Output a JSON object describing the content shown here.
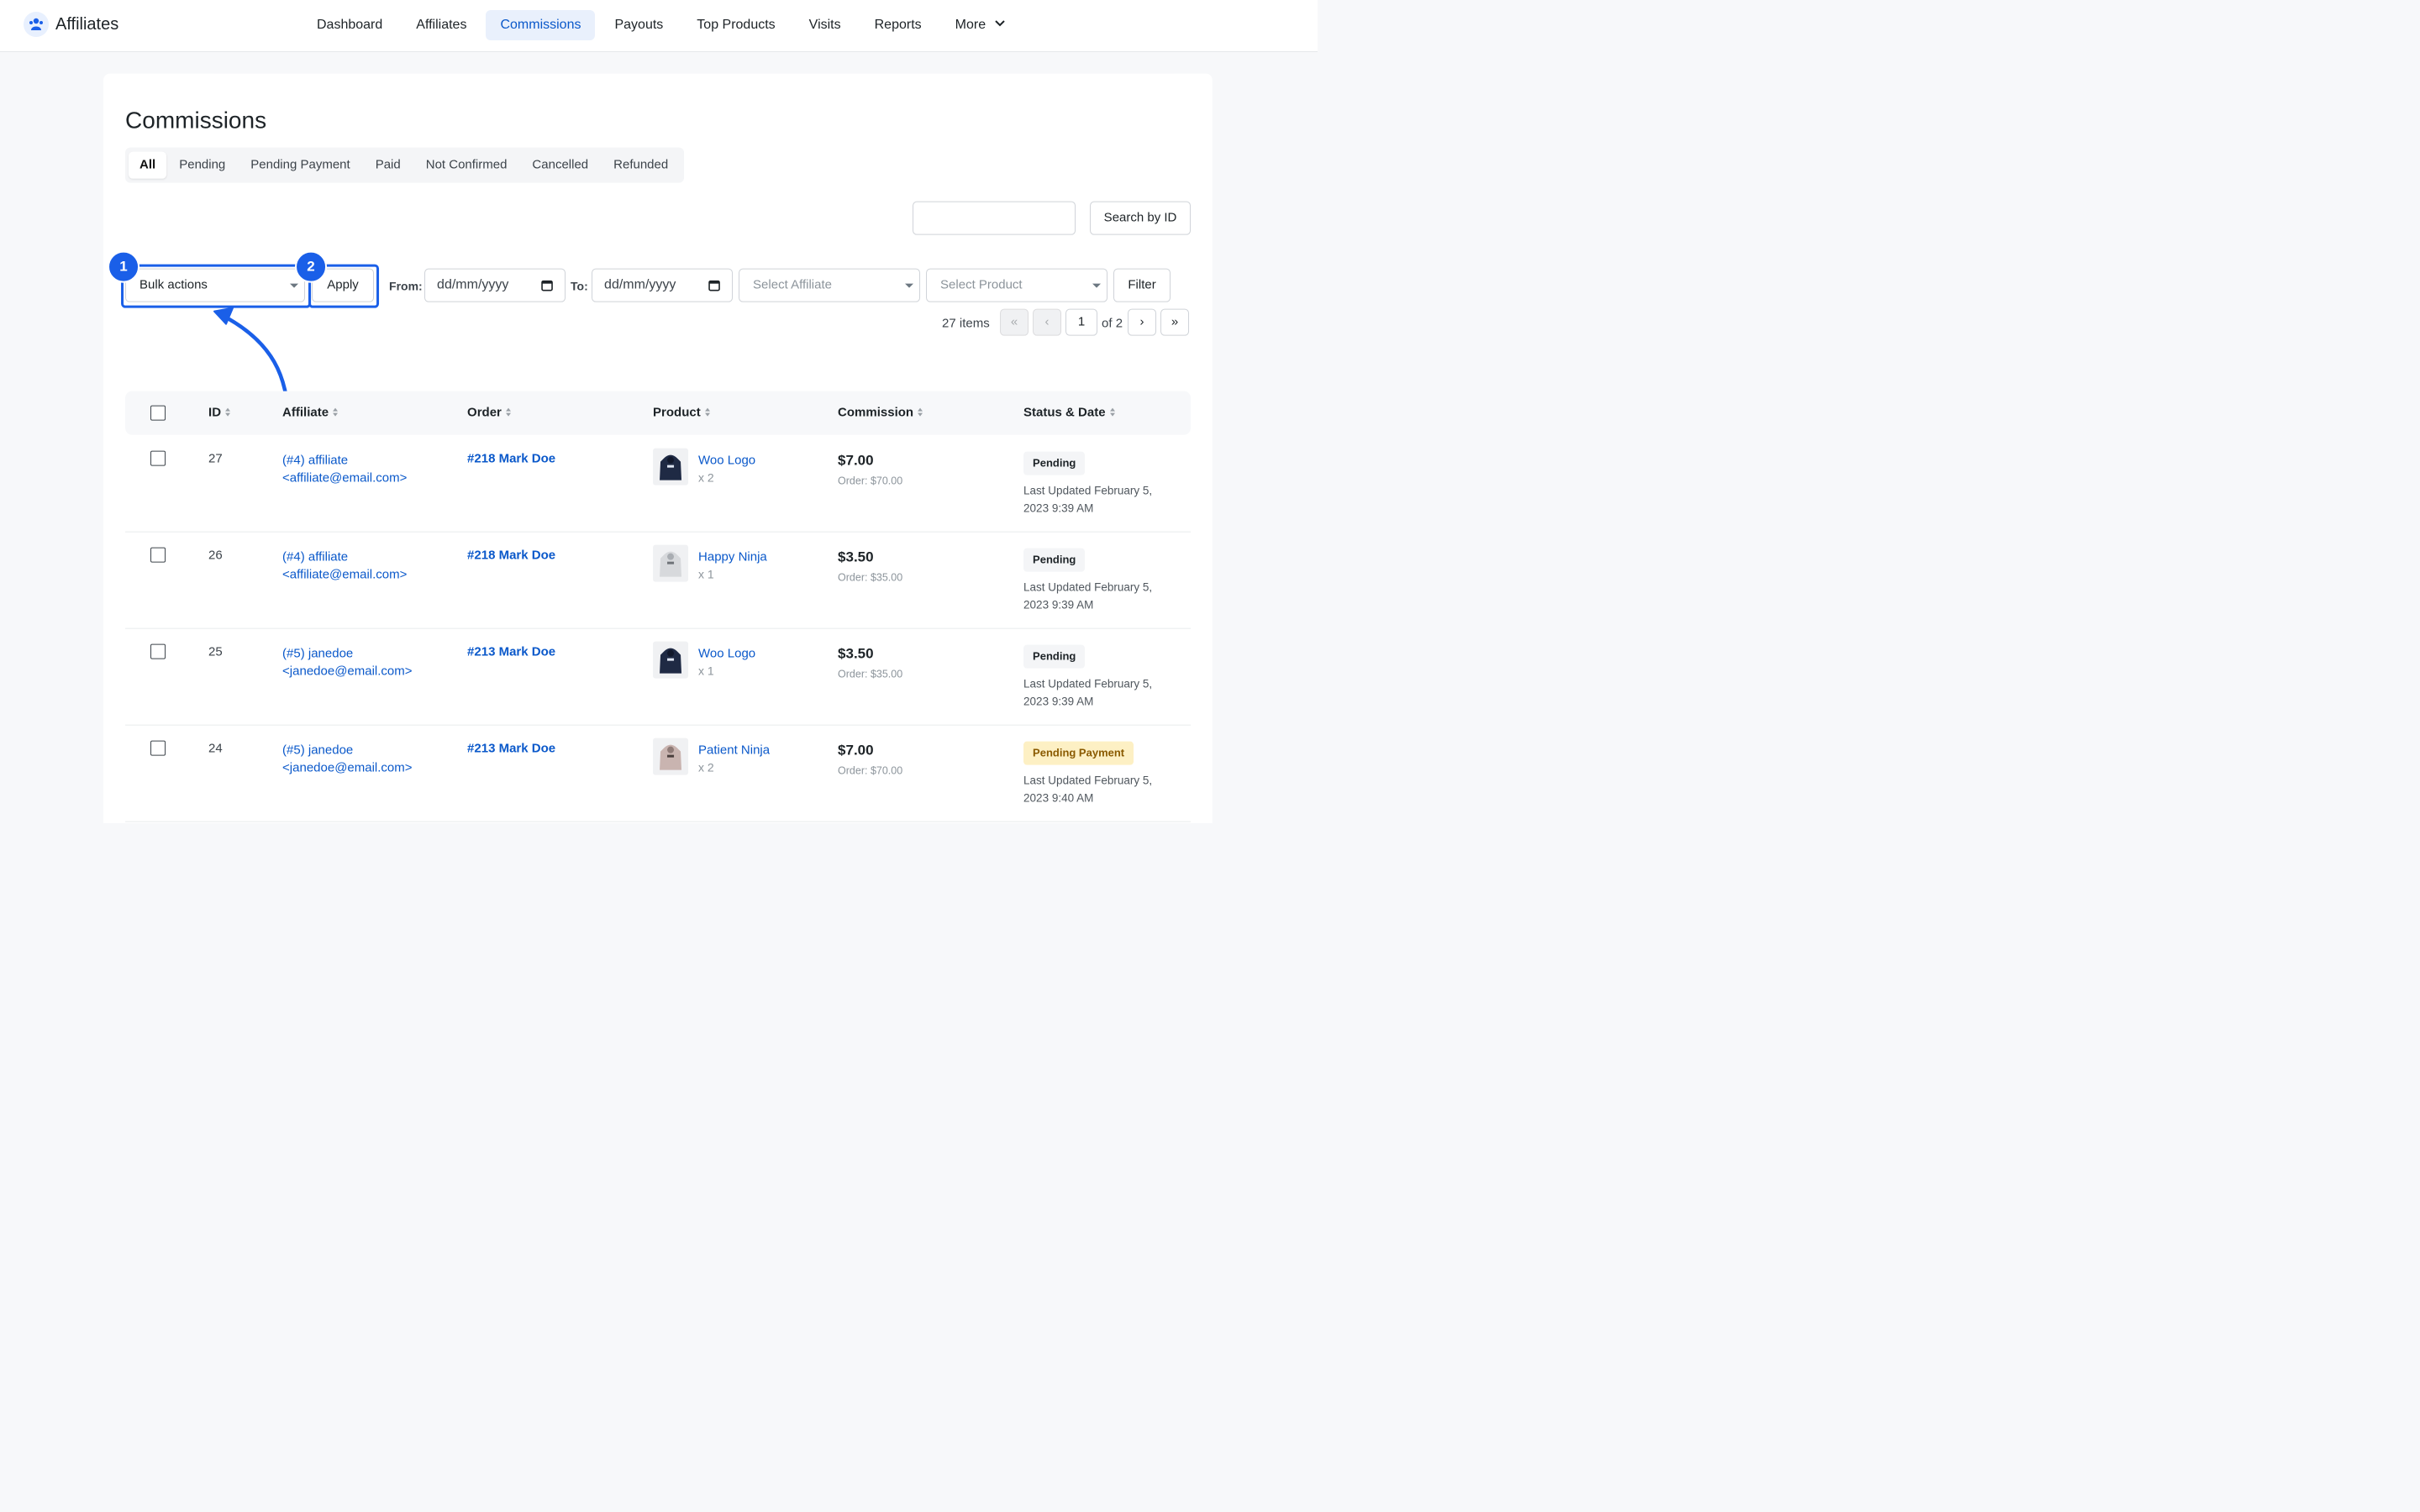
{
  "app": {
    "name": "Affiliates"
  },
  "nav": [
    {
      "label": "Dashboard"
    },
    {
      "label": "Affiliates"
    },
    {
      "label": "Commissions"
    },
    {
      "label": "Payouts"
    },
    {
      "label": "Top Products"
    },
    {
      "label": "Visits"
    },
    {
      "label": "Reports"
    },
    {
      "label": "More"
    }
  ],
  "page": {
    "title": "Commissions"
  },
  "tabs": [
    "All",
    "Pending",
    "Pending Payment",
    "Paid",
    "Not Confirmed",
    "Cancelled",
    "Refunded"
  ],
  "search": {
    "button": "Search by ID",
    "value": ""
  },
  "toolbar": {
    "bulk_actions": "Bulk actions",
    "apply": "Apply",
    "from_label": "From:",
    "to_label": "To:",
    "date_placeholder": "dd/mm/yyyy",
    "affiliate_placeholder": "Select Affiliate",
    "product_placeholder": "Select Product",
    "filter": "Filter"
  },
  "annotations": {
    "step1": "1",
    "step2": "2",
    "arrow_color": "#1a5fe8"
  },
  "pagination": {
    "items": "27 items",
    "first": "«",
    "prev": "‹",
    "current": "1",
    "of": "of 2",
    "next": "›",
    "last": "»"
  },
  "table": {
    "columns": [
      "ID",
      "Affiliate",
      "Order",
      "Product",
      "Commission",
      "Status & Date"
    ],
    "rows": [
      {
        "id": "27",
        "affiliate_line1": "(#4) affiliate",
        "affiliate_line2": "<affiliate@email.com>",
        "order": "#218 Mark Doe",
        "product": "Woo Logo",
        "qty": "x 2",
        "commission": "$7.00",
        "order_total": "Order: $70.00",
        "status": "Pending",
        "updated_line1": "Last Updated February 5,",
        "updated_line2": "2023 9:39 AM"
      },
      {
        "id": "26",
        "affiliate_line1": "(#4) affiliate",
        "affiliate_line2": "<affiliate@email.com>",
        "order": "#218 Mark Doe",
        "product": "Happy Ninja",
        "qty": "x 1",
        "commission": "$3.50",
        "order_total": "Order: $35.00",
        "status": "Pending",
        "updated_line1": "Last Updated February 5,",
        "updated_line2": "2023 9:39 AM"
      },
      {
        "id": "25",
        "affiliate_line1": "(#5) janedoe",
        "affiliate_line2": "<janedoe@email.com>",
        "order": "#213 Mark Doe",
        "product": "Woo Logo",
        "qty": "x 1",
        "commission": "$3.50",
        "order_total": "Order: $35.00",
        "status": "Pending",
        "updated_line1": "Last Updated February 5,",
        "updated_line2": "2023 9:39 AM"
      },
      {
        "id": "24",
        "affiliate_line1": "(#5) janedoe",
        "affiliate_line2": "<janedoe@email.com>",
        "order": "#213 Mark Doe",
        "product": "Patient Ninja",
        "qty": "x 2",
        "commission": "$7.00",
        "order_total": "Order: $70.00",
        "status": "Pending Payment",
        "updated_line1": "Last Updated February 5,",
        "updated_line2": "2023 9:40 AM"
      }
    ]
  },
  "colors": {
    "accent": "#0a58ca",
    "highlight": "#1a5fe8",
    "pending_payment_bg": "#fdf0c4"
  }
}
